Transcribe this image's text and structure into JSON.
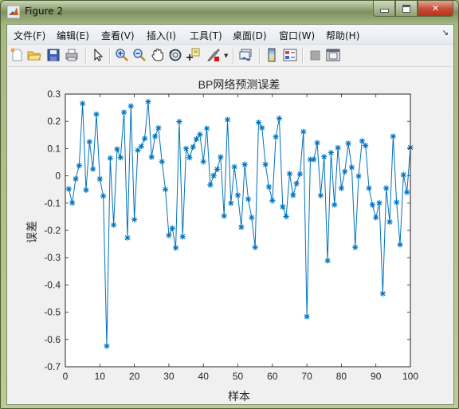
{
  "window": {
    "title": "Figure 2",
    "buttons": {
      "minimize": "minimize",
      "maximize": "maximize",
      "close": "close"
    }
  },
  "menubar": {
    "items": [
      {
        "label": "文件(F)"
      },
      {
        "label": "编辑(E)"
      },
      {
        "label": "查看(V)"
      },
      {
        "label": "插入(I)"
      },
      {
        "label": "工具(T)"
      },
      {
        "label": "桌面(D)"
      },
      {
        "label": "窗口(W)"
      },
      {
        "label": "帮助(H)"
      }
    ],
    "corner_icon": "dock-arrow-icon"
  },
  "toolbar": {
    "icons": [
      "new-figure-icon",
      "open-file-icon",
      "save-icon",
      "print-icon",
      "edit-plot-arrow-icon",
      "zoom-in-icon",
      "zoom-out-icon",
      "pan-hand-icon",
      "rotate-3d-icon",
      "data-cursor-icon",
      "brush-icon",
      "link-plot-icon",
      "colorbar-icon",
      "legend-icon",
      "hide-plot-tools-icon",
      "show-plot-tools-icon"
    ]
  },
  "colors": {
    "series": "#0072bd",
    "axes": "#262626",
    "plot_bg": "#ffffff",
    "figure_bg": "#f0f0f0"
  },
  "chart_data": {
    "type": "line",
    "title": "BP网络预测误差",
    "xlabel": "样本",
    "ylabel": "误差",
    "xlim": [
      0,
      100
    ],
    "ylim": [
      -0.7,
      0.3
    ],
    "xticks": [
      0,
      10,
      20,
      30,
      40,
      50,
      60,
      70,
      80,
      90,
      100
    ],
    "xtick_labels": [
      "0",
      "10",
      "20",
      "30",
      "40",
      "50",
      "60",
      "70",
      "80",
      "90",
      "100"
    ],
    "yticks": [
      -0.7,
      -0.6,
      -0.5,
      -0.4,
      -0.3,
      -0.2,
      -0.1,
      0,
      0.1,
      0.2,
      0.3
    ],
    "ytick_labels": [
      "-0.7",
      "-0.6",
      "-0.5",
      "-0.4",
      "-0.3",
      "-0.2",
      "-0.1",
      "0",
      "0.1",
      "0.2",
      "0.3"
    ],
    "grid": false,
    "marker": "*",
    "series": [
      {
        "name": "误差",
        "x": [
          1,
          2,
          3,
          4,
          5,
          6,
          7,
          8,
          9,
          10,
          11,
          12,
          13,
          14,
          15,
          16,
          17,
          18,
          19,
          20,
          21,
          22,
          23,
          24,
          25,
          26,
          27,
          28,
          29,
          30,
          31,
          32,
          33,
          34,
          35,
          36,
          37,
          38,
          39,
          40,
          41,
          42,
          43,
          44,
          45,
          46,
          47,
          48,
          49,
          50,
          51,
          52,
          53,
          54,
          55,
          56,
          57,
          58,
          59,
          60,
          61,
          62,
          63,
          64,
          65,
          66,
          67,
          68,
          69,
          70,
          71,
          72,
          73,
          74,
          75,
          76,
          77,
          78,
          79,
          80,
          81,
          82,
          83,
          84,
          85,
          86,
          87,
          88,
          89,
          90,
          91,
          92,
          93,
          94,
          95,
          96,
          97,
          98,
          99,
          100
        ],
        "values": [
          -0.048,
          -0.099,
          -0.011,
          0.038,
          0.265,
          -0.052,
          0.125,
          0.025,
          0.226,
          -0.011,
          -0.074,
          -0.624,
          0.065,
          -0.18,
          0.098,
          0.067,
          0.233,
          -0.227,
          0.256,
          -0.16,
          0.094,
          0.108,
          0.137,
          0.272,
          0.069,
          0.145,
          0.176,
          0.052,
          -0.05,
          -0.218,
          -0.192,
          -0.264,
          0.199,
          -0.223,
          0.1,
          0.067,
          0.106,
          0.135,
          0.152,
          0.052,
          0.174,
          -0.033,
          0.001,
          0.024,
          0.069,
          -0.147,
          0.206,
          -0.1,
          0.033,
          -0.071,
          -0.188,
          0.042,
          -0.085,
          -0.153,
          -0.262,
          0.196,
          0.176,
          0.042,
          -0.04,
          -0.091,
          0.143,
          0.211,
          -0.113,
          -0.149,
          0.008,
          -0.071,
          -0.028,
          0.007,
          0.162,
          -0.516,
          0.06,
          0.06,
          0.121,
          -0.072,
          0.07,
          -0.311,
          0.085,
          -0.106,
          0.103,
          -0.045,
          0.016,
          0.119,
          0.031,
          -0.262,
          -0.001,
          0.128,
          0.111,
          -0.045,
          -0.106,
          -0.153,
          -0.099,
          -0.432,
          -0.045,
          -0.169,
          0.145,
          -0.097,
          -0.252,
          0.004,
          -0.06,
          0.104
        ]
      }
    ]
  }
}
